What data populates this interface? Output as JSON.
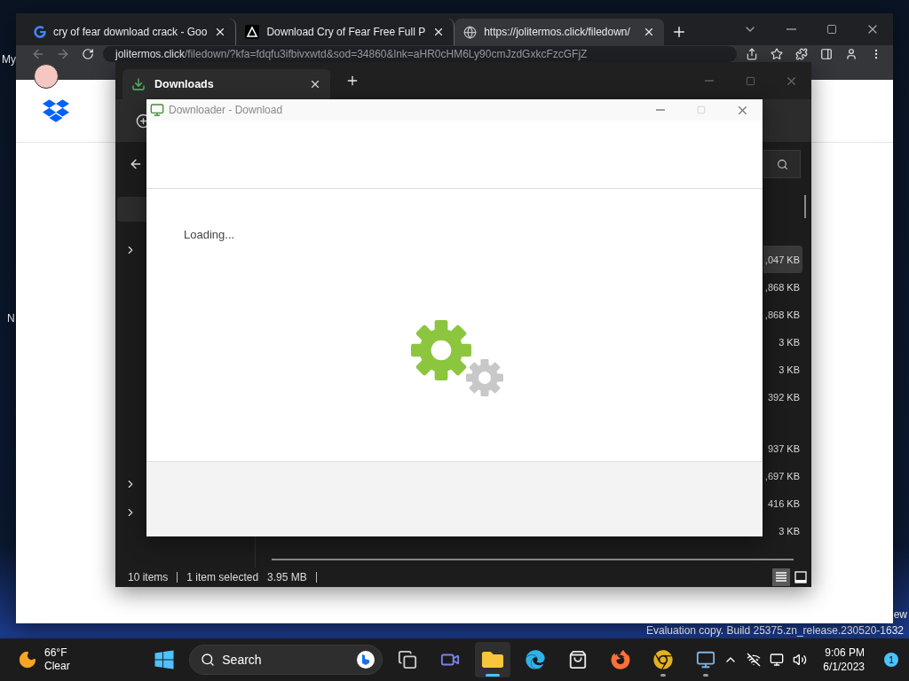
{
  "desktop": {
    "labels": [
      "My",
      "N",
      "ew"
    ],
    "build_text": "Evaluation copy. Build 25375.zn_release.230520-1632"
  },
  "browser": {
    "tabs": [
      {
        "title": "cry of fear download crack - Goo",
        "selected": false
      },
      {
        "title": "Download Cry of Fear Free Full P",
        "selected": false
      },
      {
        "title": "https://jolitermos.click/filedown/",
        "selected": true
      }
    ],
    "address_host": "jolitermos.click",
    "address_path": "/filedown/?kfa=fdqfu3ifbivxwtd&sod=34860&lnk=aHR0cHM6Ly90cmJzdGxkcFzcGFjZ"
  },
  "explorer": {
    "tab_title": "Downloads",
    "nav_top": [
      {
        "selected": true,
        "expandable": false
      },
      {
        "selected": false,
        "expandable": true
      }
    ],
    "nav_bottom": [
      {
        "selected": false,
        "expandable": true
      },
      {
        "selected": false,
        "expandable": true
      }
    ],
    "files": [
      {
        "kind": "file",
        "size": ",047 KB",
        "selected": true
      },
      {
        "kind": "file",
        "size": ",868 KB",
        "selected": false
      },
      {
        "kind": "file",
        "size": ",868 KB",
        "selected": false
      },
      {
        "kind": "file",
        "size": "3 KB",
        "selected": false
      },
      {
        "kind": "file",
        "size": "3 KB",
        "selected": false
      },
      {
        "kind": "file",
        "size": "392 KB",
        "selected": false
      },
      {
        "kind": "blank"
      },
      {
        "kind": "file",
        "size": "937 KB",
        "selected": false
      },
      {
        "kind": "file",
        "size": ",697 KB",
        "selected": false
      },
      {
        "kind": "file",
        "size": "416 KB",
        "selected": false
      },
      {
        "kind": "file",
        "size": "3 KB",
        "selected": false
      }
    ],
    "status": {
      "items": "10 items",
      "selection": "1 item selected",
      "selection_size": "3.95 MB"
    },
    "views": [
      {
        "kind": "details",
        "selected": true
      },
      {
        "kind": "tiles",
        "selected": false
      }
    ]
  },
  "dialog": {
    "title": "Downloader - Download",
    "message": "Loading..."
  },
  "taskbar": {
    "weather": {
      "temperature": "66°F",
      "condition": "Clear"
    },
    "search_label": "Search",
    "apps": [
      {
        "kind": "taskview",
        "active": false,
        "open": false
      },
      {
        "kind": "meet",
        "active": false,
        "open": false
      },
      {
        "kind": "folder",
        "active": true,
        "open": true
      },
      {
        "kind": "edge",
        "active": false,
        "open": false
      },
      {
        "kind": "store",
        "active": false,
        "open": false
      },
      {
        "kind": "firefox",
        "active": false,
        "open": false
      },
      {
        "kind": "chrome",
        "active": false,
        "open": true
      },
      {
        "kind": "installer",
        "active": false,
        "open": true
      }
    ],
    "time": "9:06 PM",
    "date": "6/1/2023",
    "notifications": "1"
  }
}
